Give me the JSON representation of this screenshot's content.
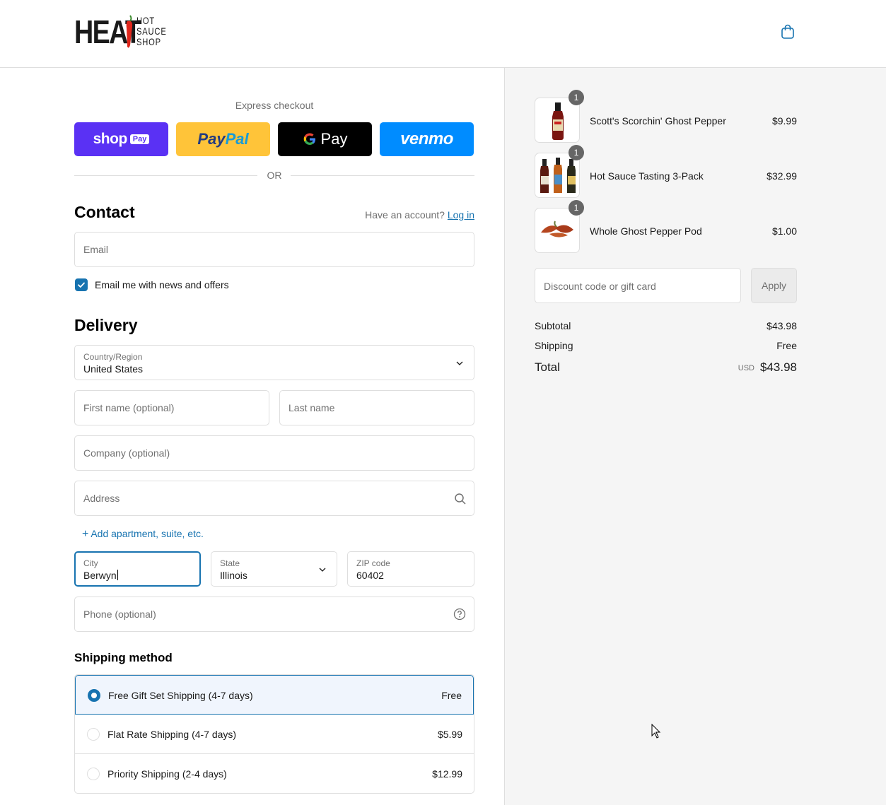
{
  "brand": {
    "name_main": "HEAT",
    "name_small": [
      "HOT",
      "SAUCE",
      "SHOP"
    ]
  },
  "header": {
    "cart_icon": "shopping-bag-icon"
  },
  "express": {
    "label": "Express checkout",
    "buttons": {
      "shop": "shop",
      "shop_chip": "Pay",
      "paypal_a": "Pay",
      "paypal_b": "Pal",
      "gpay": "Pay",
      "venmo": "venmo"
    },
    "or": "OR"
  },
  "contact": {
    "title": "Contact",
    "have_account": "Have an account?",
    "login": "Log in",
    "email_placeholder": "Email",
    "newsletter_label": "Email me with news and offers",
    "newsletter_checked": true
  },
  "delivery": {
    "title": "Delivery",
    "country_label": "Country/Region",
    "country_value": "United States",
    "first_name_placeholder": "First name (optional)",
    "last_name_placeholder": "Last name",
    "company_placeholder": "Company (optional)",
    "address_placeholder": "Address",
    "add_apartment": "Add apartment, suite, etc.",
    "city_label": "City",
    "city_value": "Berwyn",
    "state_label": "State",
    "state_value": "Illinois",
    "zip_label": "ZIP code",
    "zip_value": "60402",
    "phone_placeholder": "Phone (optional)"
  },
  "shipping": {
    "title": "Shipping method",
    "options": [
      {
        "name": "Free Gift Set Shipping (4-7 days)",
        "price": "Free",
        "selected": true
      },
      {
        "name": "Flat Rate Shipping (4-7 days)",
        "price": "$5.99",
        "selected": false
      },
      {
        "name": "Priority Shipping (2-4 days)",
        "price": "$12.99",
        "selected": false
      }
    ]
  },
  "summary": {
    "items": [
      {
        "qty": "1",
        "name": "Scott's Scorchin' Ghost Pepper",
        "price": "$9.99"
      },
      {
        "qty": "1",
        "name": "Hot Sauce Tasting 3-Pack",
        "price": "$32.99"
      },
      {
        "qty": "1",
        "name": "Whole Ghost Pepper Pod",
        "price": "$1.00"
      }
    ],
    "discount_placeholder": "Discount code or gift card",
    "apply": "Apply",
    "subtotal_label": "Subtotal",
    "subtotal": "$43.98",
    "shipping_label": "Shipping",
    "shipping": "Free",
    "total_label": "Total",
    "currency": "USD",
    "total": "$43.98"
  },
  "colors": {
    "accent": "#1773b0",
    "shop_pay": "#5a31f4",
    "paypal": "#ffc439",
    "venmo": "#008cff",
    "summary_bg": "#f5f5f5"
  }
}
